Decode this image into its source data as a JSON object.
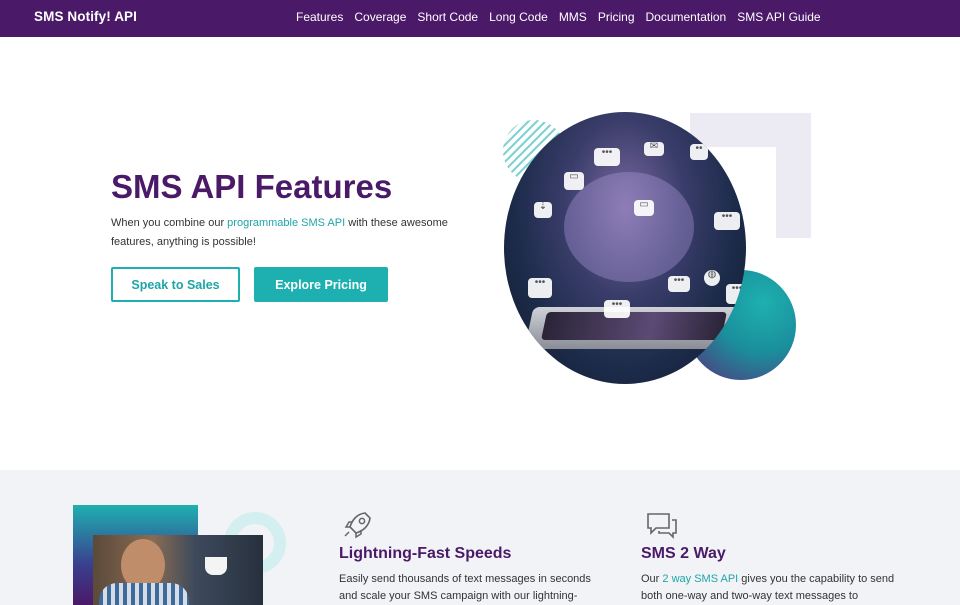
{
  "nav": {
    "brand": "SMS Notify! API",
    "links": [
      "Features",
      "Coverage",
      "Short Code",
      "Long Code",
      "MMS",
      "Pricing",
      "Documentation",
      "SMS API Guide"
    ]
  },
  "hero": {
    "title": "SMS API Features",
    "desc_before": "When you combine our ",
    "desc_link": "programmable SMS API",
    "desc_after": " with these awesome features, anything is possible!",
    "button_sales": "Speak to Sales",
    "button_pricing": "Explore Pricing"
  },
  "features": [
    {
      "icon": "rocket-icon",
      "title": "Lightning-Fast Speeds",
      "text_before": "Easily send thousands of text messages in seconds and scale your SMS campaign with our lightning-",
      "text_link": "",
      "text_after": ""
    },
    {
      "icon": "chat-bubbles-icon",
      "title": "SMS 2 Way",
      "text_before": "Our ",
      "text_link": "2 way SMS API",
      "text_after": " gives you the capability to send both one-way and two-way text messages to"
    }
  ],
  "colors": {
    "brand_purple": "#4a1968",
    "accent_teal": "#1eb0b0",
    "section_bg": "#f1f3f7"
  }
}
